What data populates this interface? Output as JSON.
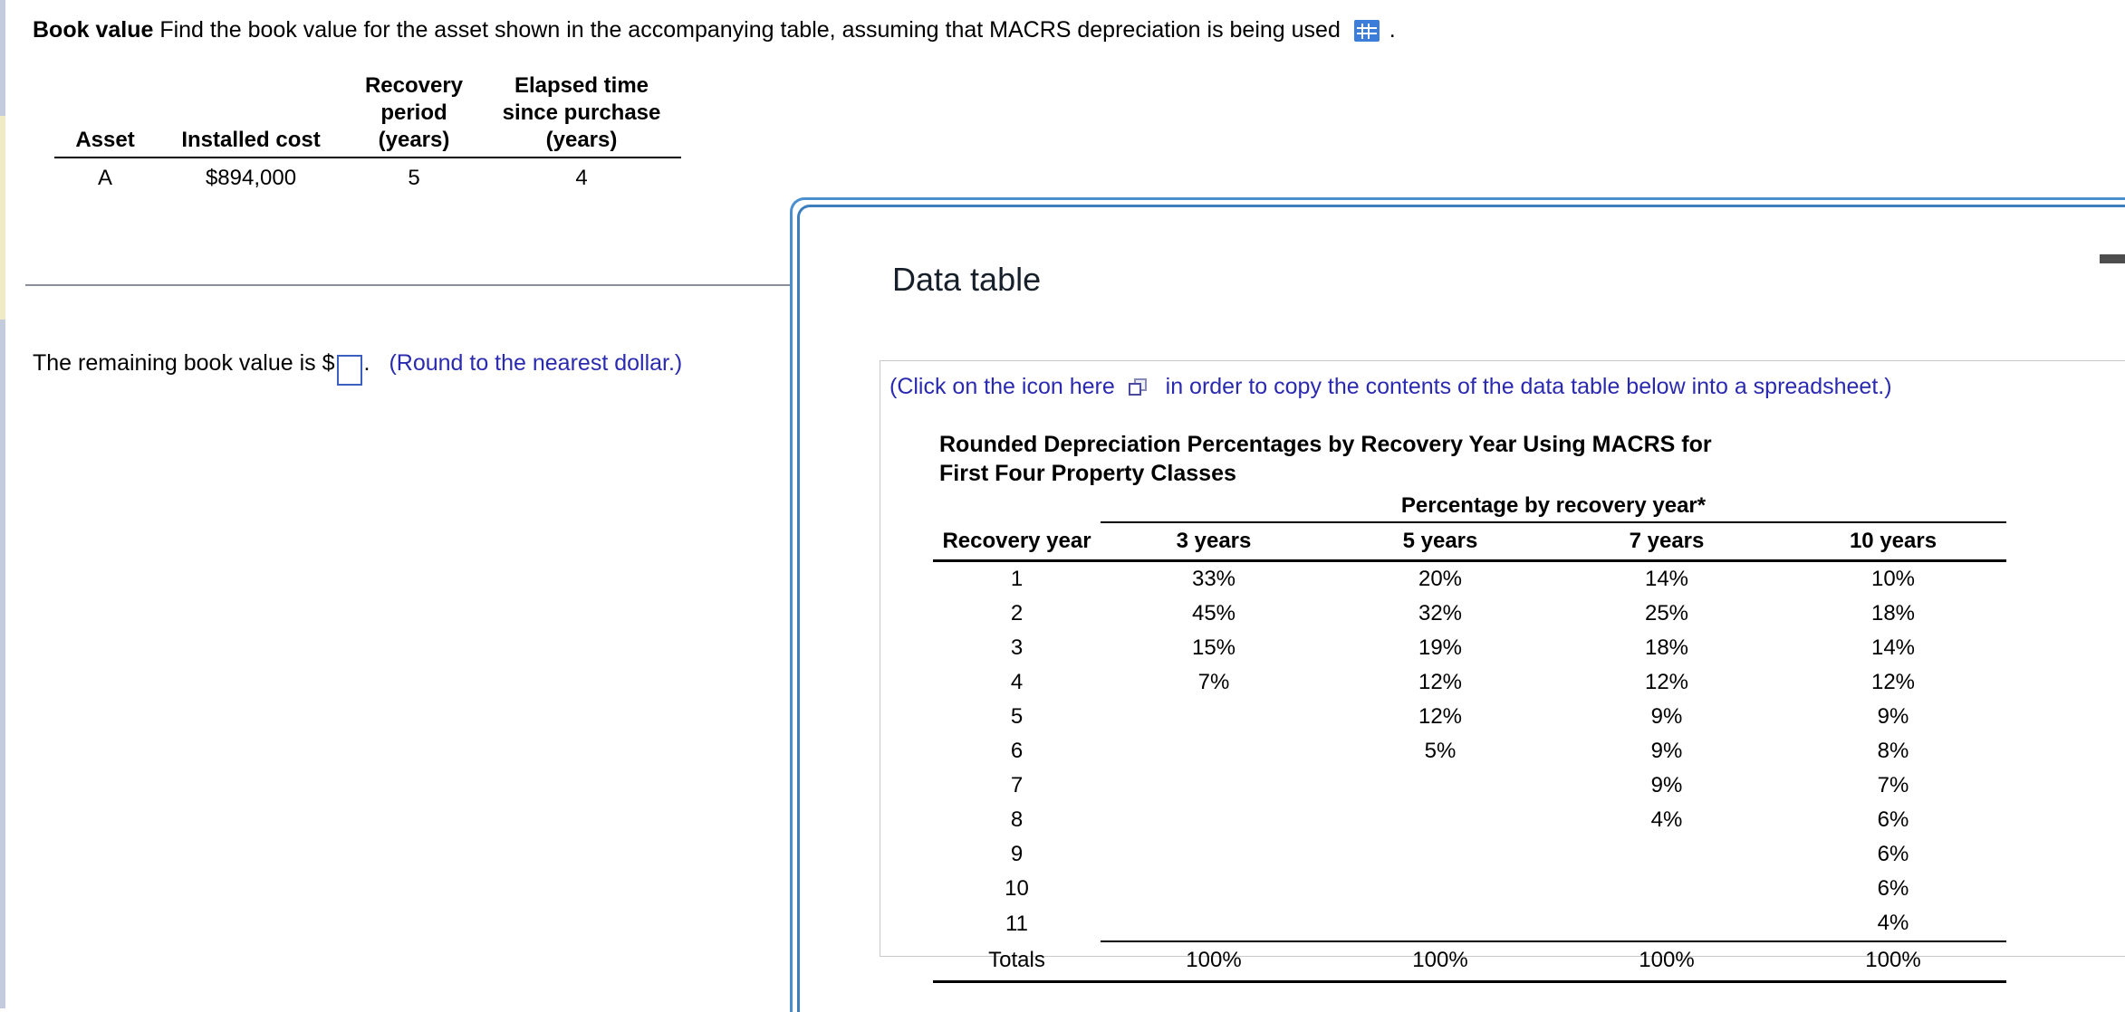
{
  "problem": {
    "label": "Book value",
    "text": "Find the book value for the asset shown in the accompanying table, assuming that MACRS depreciation is being used",
    "icon": "grid-icon",
    "period": "."
  },
  "asset_table": {
    "headers": [
      "Asset",
      "Installed cost",
      "Recovery period (years)",
      "Elapsed time since purchase (years)"
    ],
    "header_lines": {
      "asset": "Asset",
      "installed_cost": "Installed cost",
      "recovery_period": "Recovery\nperiod\n(years)",
      "elapsed_time": "Elapsed time\nsince purchase\n(years)"
    },
    "rows": [
      {
        "asset": "A",
        "installed_cost": "$894,000",
        "recovery_period": "5",
        "elapsed_time": "4"
      }
    ]
  },
  "answer": {
    "prefix": "The remaining book value is $",
    "value": "",
    "suffix": ".",
    "note": "(Round to the nearest dollar.)"
  },
  "dialog": {
    "title": "Data table",
    "minimize_icon": "minimize-icon",
    "copy_note_before": "(Click on the icon here",
    "copy_icon": "copy-icon",
    "copy_note_after": "in order to copy the contents of the data table below into a spreadsheet.)"
  },
  "chart_data": {
    "type": "table",
    "title": "Rounded Depreciation Percentages by Recovery Year Using MACRS for First Four Property Classes",
    "group_header": "Percentage by recovery year*",
    "row_header": "Recovery year",
    "categories": [
      "3 years",
      "5 years",
      "7 years",
      "10 years"
    ],
    "rows": [
      {
        "year": "1",
        "values": [
          "33%",
          "20%",
          "14%",
          "10%"
        ]
      },
      {
        "year": "2",
        "values": [
          "45%",
          "32%",
          "25%",
          "18%"
        ]
      },
      {
        "year": "3",
        "values": [
          "15%",
          "19%",
          "18%",
          "14%"
        ]
      },
      {
        "year": "4",
        "values": [
          "7%",
          "12%",
          "12%",
          "12%"
        ]
      },
      {
        "year": "5",
        "values": [
          "",
          "12%",
          "9%",
          "9%"
        ]
      },
      {
        "year": "6",
        "values": [
          "",
          "5%",
          "9%",
          "8%"
        ]
      },
      {
        "year": "7",
        "values": [
          "",
          "",
          "9%",
          "7%"
        ]
      },
      {
        "year": "8",
        "values": [
          "",
          "",
          "4%",
          "6%"
        ]
      },
      {
        "year": "9",
        "values": [
          "",
          "",
          "",
          "6%"
        ]
      },
      {
        "year": "10",
        "values": [
          "",
          "",
          "",
          "6%"
        ]
      },
      {
        "year": "11",
        "values": [
          "",
          "",
          "",
          "4%"
        ]
      }
    ],
    "totals_label": "Totals",
    "totals": [
      "100%",
      "100%",
      "100%",
      "100%"
    ]
  },
  "colors": {
    "link_blue": "#2a2ab0",
    "dialog_border": "#3d7fbd",
    "input_border": "#3b5fc0",
    "grid_icon": "#3b7dd8",
    "rail_blue": "#c3cbdc",
    "rail_yellow": "#f0ebc4"
  }
}
